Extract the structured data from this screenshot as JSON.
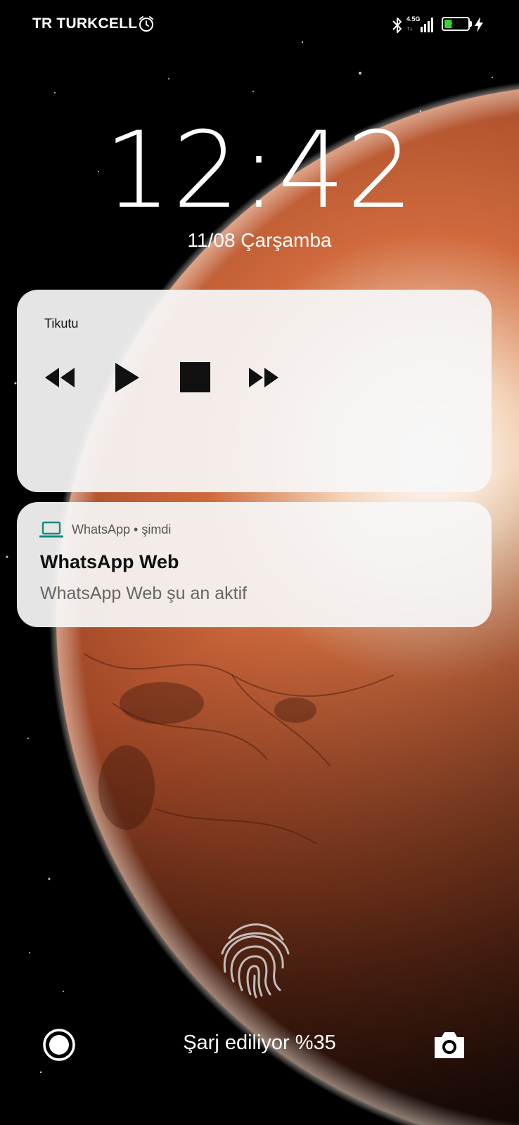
{
  "status_bar": {
    "carrier": "TR TURKCELL",
    "network_type": "4.5G",
    "network_arrows": "↑↓",
    "battery_percent": "35",
    "battery_level": 0.35,
    "icons": [
      "alarm-icon",
      "bluetooth-icon",
      "signal-icon",
      "battery-icon",
      "charging-bolt-icon"
    ]
  },
  "lockscreen": {
    "time": "12:42",
    "date": "11/08 Çarşamba"
  },
  "media_player": {
    "app_title": "Tikutu",
    "controls": [
      "rewind-icon",
      "play-icon",
      "stop-icon",
      "fast-forward-icon"
    ]
  },
  "notification": {
    "app_name": "WhatsApp • şimdi",
    "title": "WhatsApp Web",
    "text": "WhatsApp Web şu an aktif",
    "icon": "laptop-icon",
    "accent": "#128C7E"
  },
  "bottom_bar": {
    "charging_text": "Şarj ediliyor %35",
    "left_icon": "record-icon",
    "right_icon": "camera-icon"
  },
  "colors": {
    "background": "#000000",
    "planet": "#b5542c",
    "card": "#f4f4f4",
    "battery_fill": "#3ad13a"
  }
}
